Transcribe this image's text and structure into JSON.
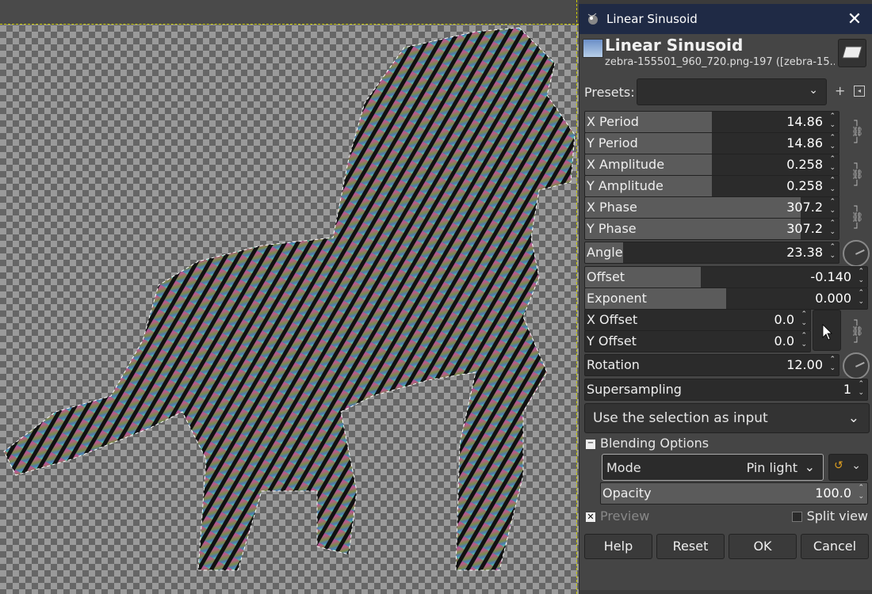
{
  "dialog": {
    "window_title": "Linear Sinusoid",
    "filter_name": "Linear Sinusoid",
    "image_subtitle": "zebra-155501_960_720.png-197 ([zebra-15...",
    "presets_label": "Presets:",
    "presets_value": "",
    "fields": {
      "x_period": {
        "label": "X Period",
        "value": "14.86",
        "fill": 0.5
      },
      "y_period": {
        "label": "Y Period",
        "value": "14.86",
        "fill": 0.5
      },
      "x_amplitude": {
        "label": "X Amplitude",
        "value": "0.258",
        "fill": 0.5
      },
      "y_amplitude": {
        "label": "Y Amplitude",
        "value": "0.258",
        "fill": 0.5
      },
      "x_phase": {
        "label": "X Phase",
        "value": "307.2",
        "fill": 0.85
      },
      "y_phase": {
        "label": "Y Phase",
        "value": "307.2",
        "fill": 0.85
      },
      "angle": {
        "label": "Angle",
        "value": "23.38",
        "fill": 0.15
      },
      "offset": {
        "label": "Offset",
        "value": "-0.140",
        "fill": 0.41
      },
      "exponent": {
        "label": "Exponent",
        "value": "0.000",
        "fill": 0.5
      },
      "x_offset": {
        "label": "X Offset",
        "value": "0.0",
        "fill": 0.0
      },
      "y_offset": {
        "label": "Y Offset",
        "value": "0.0",
        "fill": 0.0
      },
      "rotation": {
        "label": "Rotation",
        "value": "12.00",
        "fill": 0.0
      },
      "supersampling": {
        "label": "Supersampling",
        "value": "1",
        "fill": 0.0
      }
    },
    "selection_input": "Use the selection as input",
    "blending_header": "Blending Options",
    "mode_label": "Mode",
    "mode_value": "Pin light",
    "opacity_label": "Opacity",
    "opacity_value": "100.0",
    "opacity_fill": 1.0,
    "preview_label": "Preview",
    "preview_checked": true,
    "split_view_label": "Split view",
    "split_view_checked": false,
    "buttons": {
      "help": "Help",
      "reset": "Reset",
      "ok": "OK",
      "cancel": "Cancel"
    }
  },
  "icons": [
    "gimp-wilber-icon",
    "close-icon",
    "filter-thumbnail-icon",
    "chevron-down-icon",
    "add-preset-icon",
    "preset-menu-icon",
    "chain-link-icon",
    "angle-dial-icon",
    "pointer-pick-icon",
    "reset-rotate-icon",
    "checkbox-icon"
  ],
  "colors": {
    "title_bar": "#1f2a45",
    "dialog_bg": "#454545",
    "field_bg": "#2b2b2b",
    "field_fill": "#5b5b5b",
    "selection_marching_ants": "#c8c800"
  }
}
